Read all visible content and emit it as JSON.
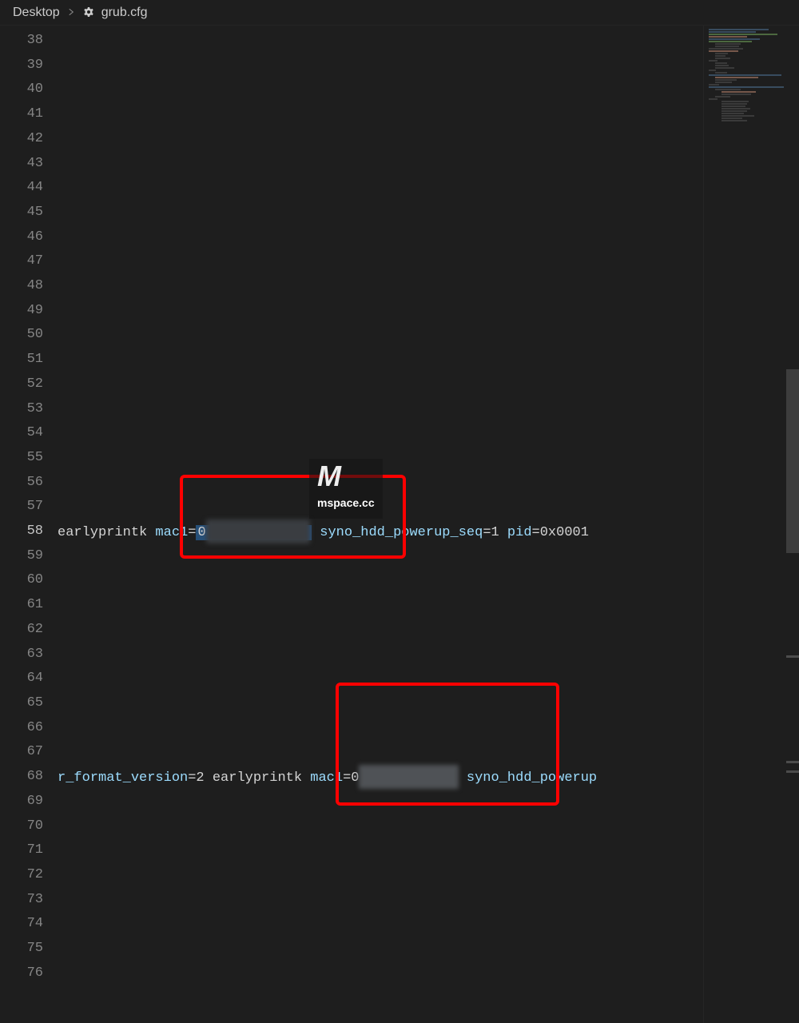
{
  "breadcrumb": {
    "parent": "Desktop",
    "file": "grub.cfg"
  },
  "editor": {
    "first_line_number": 38,
    "last_line_number": 76,
    "active_line": 58,
    "line58": {
      "t1": "earlyprintk",
      "key1": "mac1",
      "val1_prefix": "0",
      "redacted1": "xxxxxxxxxxxx",
      "key2": "syno_hdd_powerup_seq",
      "val2": "1",
      "key3": "pid",
      "val3": "0x0001"
    },
    "line68": {
      "key0": "r_format_version",
      "val0": "2",
      "t1": "earlyprintk",
      "key1": "mac1",
      "val1_prefix": "0",
      "redacted1": "xxxxxxxxxxx",
      "key2": "syno_hdd_powerup"
    }
  },
  "watermark": {
    "text": "mspace.cc"
  }
}
